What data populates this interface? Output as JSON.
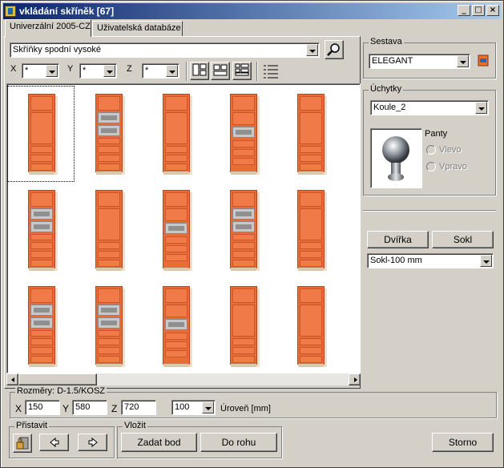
{
  "window": {
    "title": "vkládání skříněk [67]",
    "min": "_",
    "max": "□",
    "close": "×"
  },
  "tabs": [
    {
      "label": "Univerzální 2005-CZ",
      "active": true
    },
    {
      "label": "Uživatelská databáze",
      "active": false
    }
  ],
  "filter": {
    "category": "Skříňky spodní vysoké",
    "x_label": "X",
    "y_label": "Y",
    "z_label": "Z",
    "x_value": "*",
    "y_value": "*",
    "z_value": "*"
  },
  "catalog": {
    "rows": 3,
    "cols": 5,
    "selected_index": 0
  },
  "sestava": {
    "title": "Sestava",
    "value": "ELEGANT"
  },
  "uchytky": {
    "title": "Úchytky",
    "value": "Koule_2",
    "panty_label": "Panty",
    "vlevo": "Vlevo",
    "vpravo": "Vpravo"
  },
  "buttons": {
    "dvirka": "Dvířka",
    "sokl": "Sokl",
    "zadat_bod": "Zadat bod",
    "do_rohu": "Do rohu",
    "storno": "Storno"
  },
  "sokl_select": "Sokl-100 mm",
  "rozmery": {
    "title": "Rozměry: D-1.5/KOSZ",
    "x_label": "X",
    "y_label": "Y",
    "z_label": "Z",
    "x": "150",
    "y": "580",
    "z": "720",
    "level_value": "100",
    "level_label": "Úroveň [mm]"
  },
  "pristavit": {
    "title": "Přistavit"
  },
  "vlozit": {
    "title": "Vložit"
  }
}
